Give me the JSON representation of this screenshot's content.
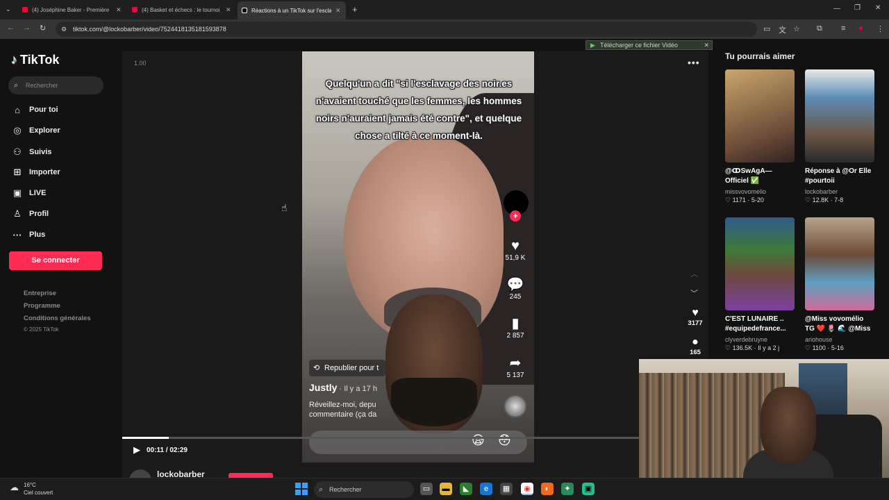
{
  "browser": {
    "tabs": [
      {
        "label": "(4) Joséphine Baker - Première",
        "favicon_color": "#ff0033"
      },
      {
        "label": "(4) Basket et échecs : le tournoi",
        "favicon_color": "#ff0033"
      },
      {
        "label": "Réactions à un TikTok sur l'escla",
        "favicon_color": "#000000"
      }
    ],
    "url": "tiktok.com/@lockobarber/video/7524418135181593878"
  },
  "tiktok": {
    "logo": "TikTok",
    "search_placeholder": "Rechercher",
    "nav": [
      {
        "label": "Pour toi",
        "icon": "home-icon"
      },
      {
        "label": "Explorer",
        "icon": "compass-icon"
      },
      {
        "label": "Suivis",
        "icon": "following-icon"
      },
      {
        "label": "Importer",
        "icon": "upload-icon"
      },
      {
        "label": "LIVE",
        "icon": "live-icon"
      },
      {
        "label": "Profil",
        "icon": "profile-icon"
      },
      {
        "label": "Plus",
        "icon": "more-icon"
      }
    ],
    "login_label": "Se connecter",
    "footer": [
      "Entreprise",
      "Programme",
      "Conditions générales",
      "© 2025 TikTok"
    ],
    "accent": "#fe2c55"
  },
  "player": {
    "speed": "1.00",
    "caption": "Quelqu'un a dit \"si l'esclavage des noir.es n'avaient touché que les femmes, les hommes noirs n'auraient jamais été contre\", et quelque chose a tilté à ce moment-là.",
    "repost_label": "Republier pour t",
    "comment_user": "Justly",
    "comment_time": " · Il y a 17 h",
    "comment_text": "Réveillez-moi, depu commentaire (ça da",
    "actions": {
      "likes": "51,9 K",
      "comments": "245",
      "saves": "2 857",
      "shares": "5 137"
    },
    "side_likes": "3177",
    "side_comments": "165",
    "time": "00:11 / 02:29",
    "progress": 0.09,
    "download_label": "Télécharger ce fichier Vidéo",
    "bottom_user": "lockobarber"
  },
  "recommendations": {
    "title": "Tu pourrais aimer",
    "cards": [
      {
        "title": "@ↀSwAgA—Officiel ✅",
        "user": "missvovomelio",
        "stats": "♡ 1171 · 5-20",
        "color": "#8b6f55"
      },
      {
        "title": "Réponse à @Or Elle #pourtoii",
        "user": "lockobarber",
        "stats": "♡ 12.8K · 7-8",
        "color": "#3a6a8a"
      },
      {
        "title": "C'EST LUNAIRE .. #equipedefrance...",
        "user": "clyverdebruyne",
        "stats": "♡ 136.5K · Il y a 2 j",
        "color": "#3e6b3a"
      },
      {
        "title": "@Miss vovomélio TG ❤️ 🌷 🌊 @Miss ép...",
        "user": "ariohouse",
        "stats": "♡ 1100 · 5-16",
        "color": "#8a7055"
      }
    ]
  },
  "taskbar": {
    "temp": "16°C",
    "weather": "Ciel couvert",
    "search": "Rechercher"
  }
}
